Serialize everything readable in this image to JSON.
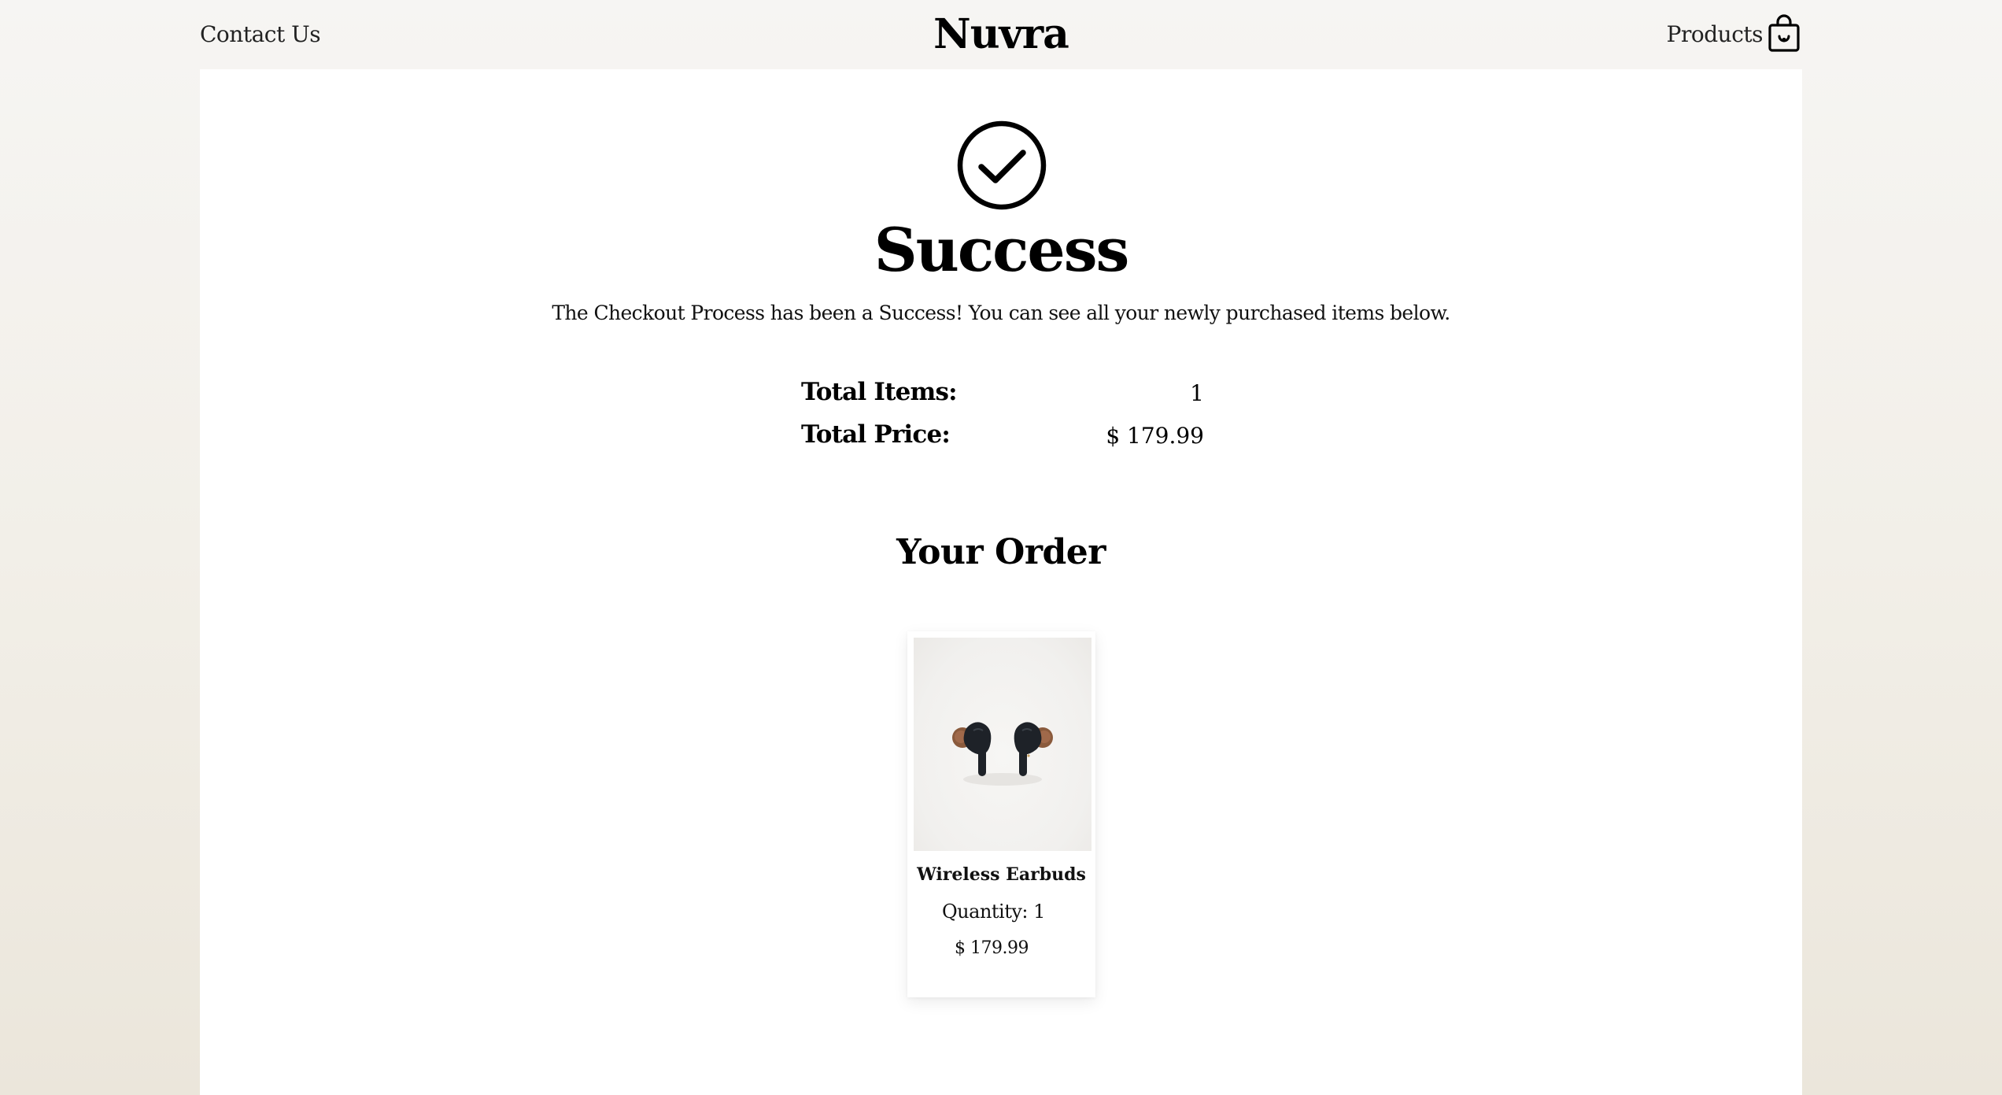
{
  "header": {
    "contact_label": "Contact Us",
    "logo": "Nuvra",
    "products_label": "Products"
  },
  "success": {
    "title": "Success",
    "message": "The Checkout Process has been a Success! You can see all your newly purchased items below."
  },
  "summary": {
    "total_items_label": "Total Items:",
    "total_items_value": "1",
    "total_price_label": "Total Price:",
    "total_price_value": "$ 179.99"
  },
  "order": {
    "title": "Your Order",
    "items": [
      {
        "name": "Wireless Earbuds",
        "quantity": "Quantity: 1",
        "price": "$ 179.99"
      }
    ]
  },
  "icons": {
    "success": "check-circle-icon",
    "cart": "shopping-bag-icon"
  },
  "colors": {
    "text": "#000000",
    "panel": "#ffffff",
    "background": "#f2efe8"
  }
}
